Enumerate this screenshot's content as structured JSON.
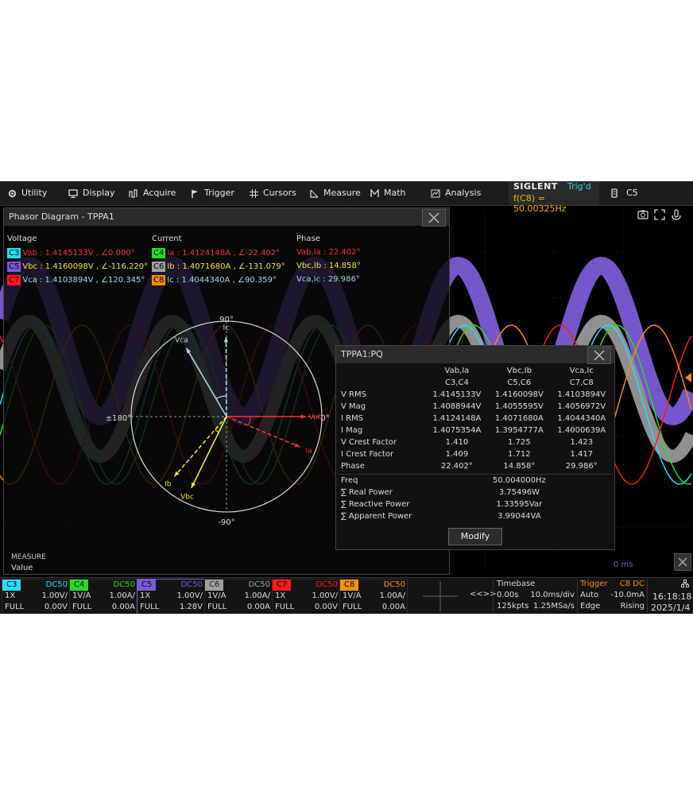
{
  "menu": {
    "items": [
      "Utility",
      "Display",
      "Acquire",
      "Trigger",
      "Cursors",
      "Measure",
      "Math",
      "Analysis"
    ]
  },
  "brand": {
    "logo": "SIGLENT",
    "trigger_state": "Trig'd",
    "frequency": "f(C8) = 50.00325Hz",
    "active_channel": "C5"
  },
  "waveform": {
    "marker_c4": "4",
    "time_marker_right": "0 ms"
  },
  "phasor": {
    "title": "Phasor Diagram - TPPA1",
    "voltage_header": "Voltage",
    "current_header": "Current",
    "phase_header": "Phase",
    "voltage": [
      {
        "ch": "C3",
        "text": "Vab : 1.4145133V , ∠0.000°",
        "chip_color": "#1ee0ff",
        "text_color": "#ff3030"
      },
      {
        "ch": "C5",
        "text": "Vbc : 1.4160098V , ∠-116.220°",
        "chip_color": "#7b5cd6",
        "text_color": "#f2e830"
      },
      {
        "ch": "C7",
        "text": "Vca : 1.4103894V , ∠120.345°",
        "chip_color": "#ff1a1a",
        "text_color": "#a8d8ea"
      }
    ],
    "current": [
      {
        "ch": "C4",
        "text": "Ia : 1.4124148A , ∠-22.402°",
        "chip_color": "#22e022",
        "text_color": "#ff3030"
      },
      {
        "ch": "C6",
        "text": "Ib : 1.4071680A , ∠-131.079°",
        "chip_color": "#a0a0a0",
        "text_color": "#f2e830"
      },
      {
        "ch": "C8",
        "text": "Ic : 1.4044340A , ∠90.359°",
        "chip_color": "#ff8c00",
        "text_color": "#a8d8ea"
      }
    ],
    "phase": [
      {
        "text": "Vab,Ia : 22.402°",
        "color": "#ff3030"
      },
      {
        "text": "Vbc,Ib : 14.858°",
        "color": "#f2e830"
      },
      {
        "text": "Vca,Ic : 29.986°",
        "color": "#a8d8ea"
      }
    ],
    "diagram": {
      "label_90": "90°",
      "label_180": "±180°",
      "label_0": "0°",
      "label_neg90": "-90°",
      "vectors": [
        {
          "name": "Vab",
          "angle": 0,
          "mag": 1.0,
          "color": "#ff3030",
          "dashed": false
        },
        {
          "name": "Ia",
          "angle": -22.402,
          "mag": 1.0,
          "color": "#ff3030",
          "dashed": true
        },
        {
          "name": "Vbc",
          "angle": -116.22,
          "mag": 1.0,
          "color": "#f2e830",
          "dashed": false
        },
        {
          "name": "Ib",
          "angle": -131.079,
          "mag": 1.0,
          "color": "#f2e830",
          "dashed": true
        },
        {
          "name": "Vca",
          "angle": 120.345,
          "mag": 1.0,
          "color": "#a8d8ea",
          "dashed": false
        },
        {
          "name": "Ic",
          "angle": 90.359,
          "mag": 1.0,
          "color": "#a8d8ea",
          "dashed": true
        }
      ]
    }
  },
  "pq": {
    "title": "TPPA1:PQ",
    "columns": [
      "Vab,Ia",
      "Vbc,Ib",
      "Vca,Ic"
    ],
    "sources": [
      "C3,C4",
      "C5,C6",
      "C7,C8"
    ],
    "rows": [
      {
        "label": "V RMS",
        "values": [
          "1.4145133V",
          "1.4160098V",
          "1.4103894V"
        ]
      },
      {
        "label": "V Mag",
        "values": [
          "1.4088944V",
          "1.4055595V",
          "1.4056972V"
        ]
      },
      {
        "label": "I RMS",
        "values": [
          "1.4124148A",
          "1.4071680A",
          "1.4044340A"
        ]
      },
      {
        "label": "I Mag",
        "values": [
          "1.4075354A",
          "1.3954777A",
          "1.4000639A"
        ]
      },
      {
        "label": "V Crest Factor",
        "values": [
          "1.410",
          "1.725",
          "1.423"
        ]
      },
      {
        "label": "I Crest Factor",
        "values": [
          "1.409",
          "1.712",
          "1.417"
        ]
      },
      {
        "label": "Phase",
        "values": [
          "22.402°",
          "14.858°",
          "29.986°"
        ]
      }
    ],
    "totals": [
      {
        "label": "Freq",
        "value": "50.004000Hz"
      },
      {
        "label": "∑ Real Power",
        "value": "3.75496W"
      },
      {
        "label": "∑ Reactive Power",
        "value": "1.33595Var"
      },
      {
        "label": "∑ Apparent Power",
        "value": "3.99044VA"
      }
    ],
    "modify_label": "Modify"
  },
  "measure": {
    "title": "MEASURE",
    "value_label": "Value"
  },
  "channels": [
    {
      "name": "C3",
      "coupling": "DC50",
      "probe": "1X",
      "scale": "1.00V/",
      "bw": "FULL",
      "offset": "0.00V",
      "color": "#1ee0ff",
      "selected": false
    },
    {
      "name": "C4",
      "coupling": "DC50",
      "probe": "1V/A",
      "scale": "1.00A/",
      "bw": "FULL",
      "offset": "0.00A",
      "color": "#22e022",
      "selected": false
    },
    {
      "name": "C5",
      "coupling": "DC50",
      "probe": "1X",
      "scale": "1.00V/",
      "bw": "FULL",
      "offset": "1.28V",
      "color": "#7b5cd6",
      "selected": true
    },
    {
      "name": "C6",
      "coupling": "DC50",
      "probe": "1V/A",
      "scale": "1.00A/",
      "bw": "FULL",
      "offset": "0.00A",
      "color": "#a0a0a0",
      "selected": false
    },
    {
      "name": "C7",
      "coupling": "DC50",
      "probe": "1X",
      "scale": "1.00V/",
      "bw": "FULL",
      "offset": "0.00V",
      "color": "#ff1a1a",
      "selected": false
    },
    {
      "name": "C8",
      "coupling": "DC50",
      "probe": "1V/A",
      "scale": "1.00A/",
      "bw": "FULL",
      "offset": "0.00A",
      "color": "#ff8c00",
      "selected": false
    }
  ],
  "nav_label": "<<>>",
  "timebase": {
    "title": "Timebase",
    "delay": "0.00s",
    "scale": "10.0ms/div",
    "memory": "125kpts",
    "rate": "1.25MSa/s"
  },
  "trigger": {
    "title": "Trigger",
    "source": "C8 DC",
    "mode": "Auto",
    "level": "-10.0mA",
    "type": "Edge",
    "slope": "Rising"
  },
  "clock": {
    "time": "16:18:18",
    "date": "2025/1/4"
  }
}
